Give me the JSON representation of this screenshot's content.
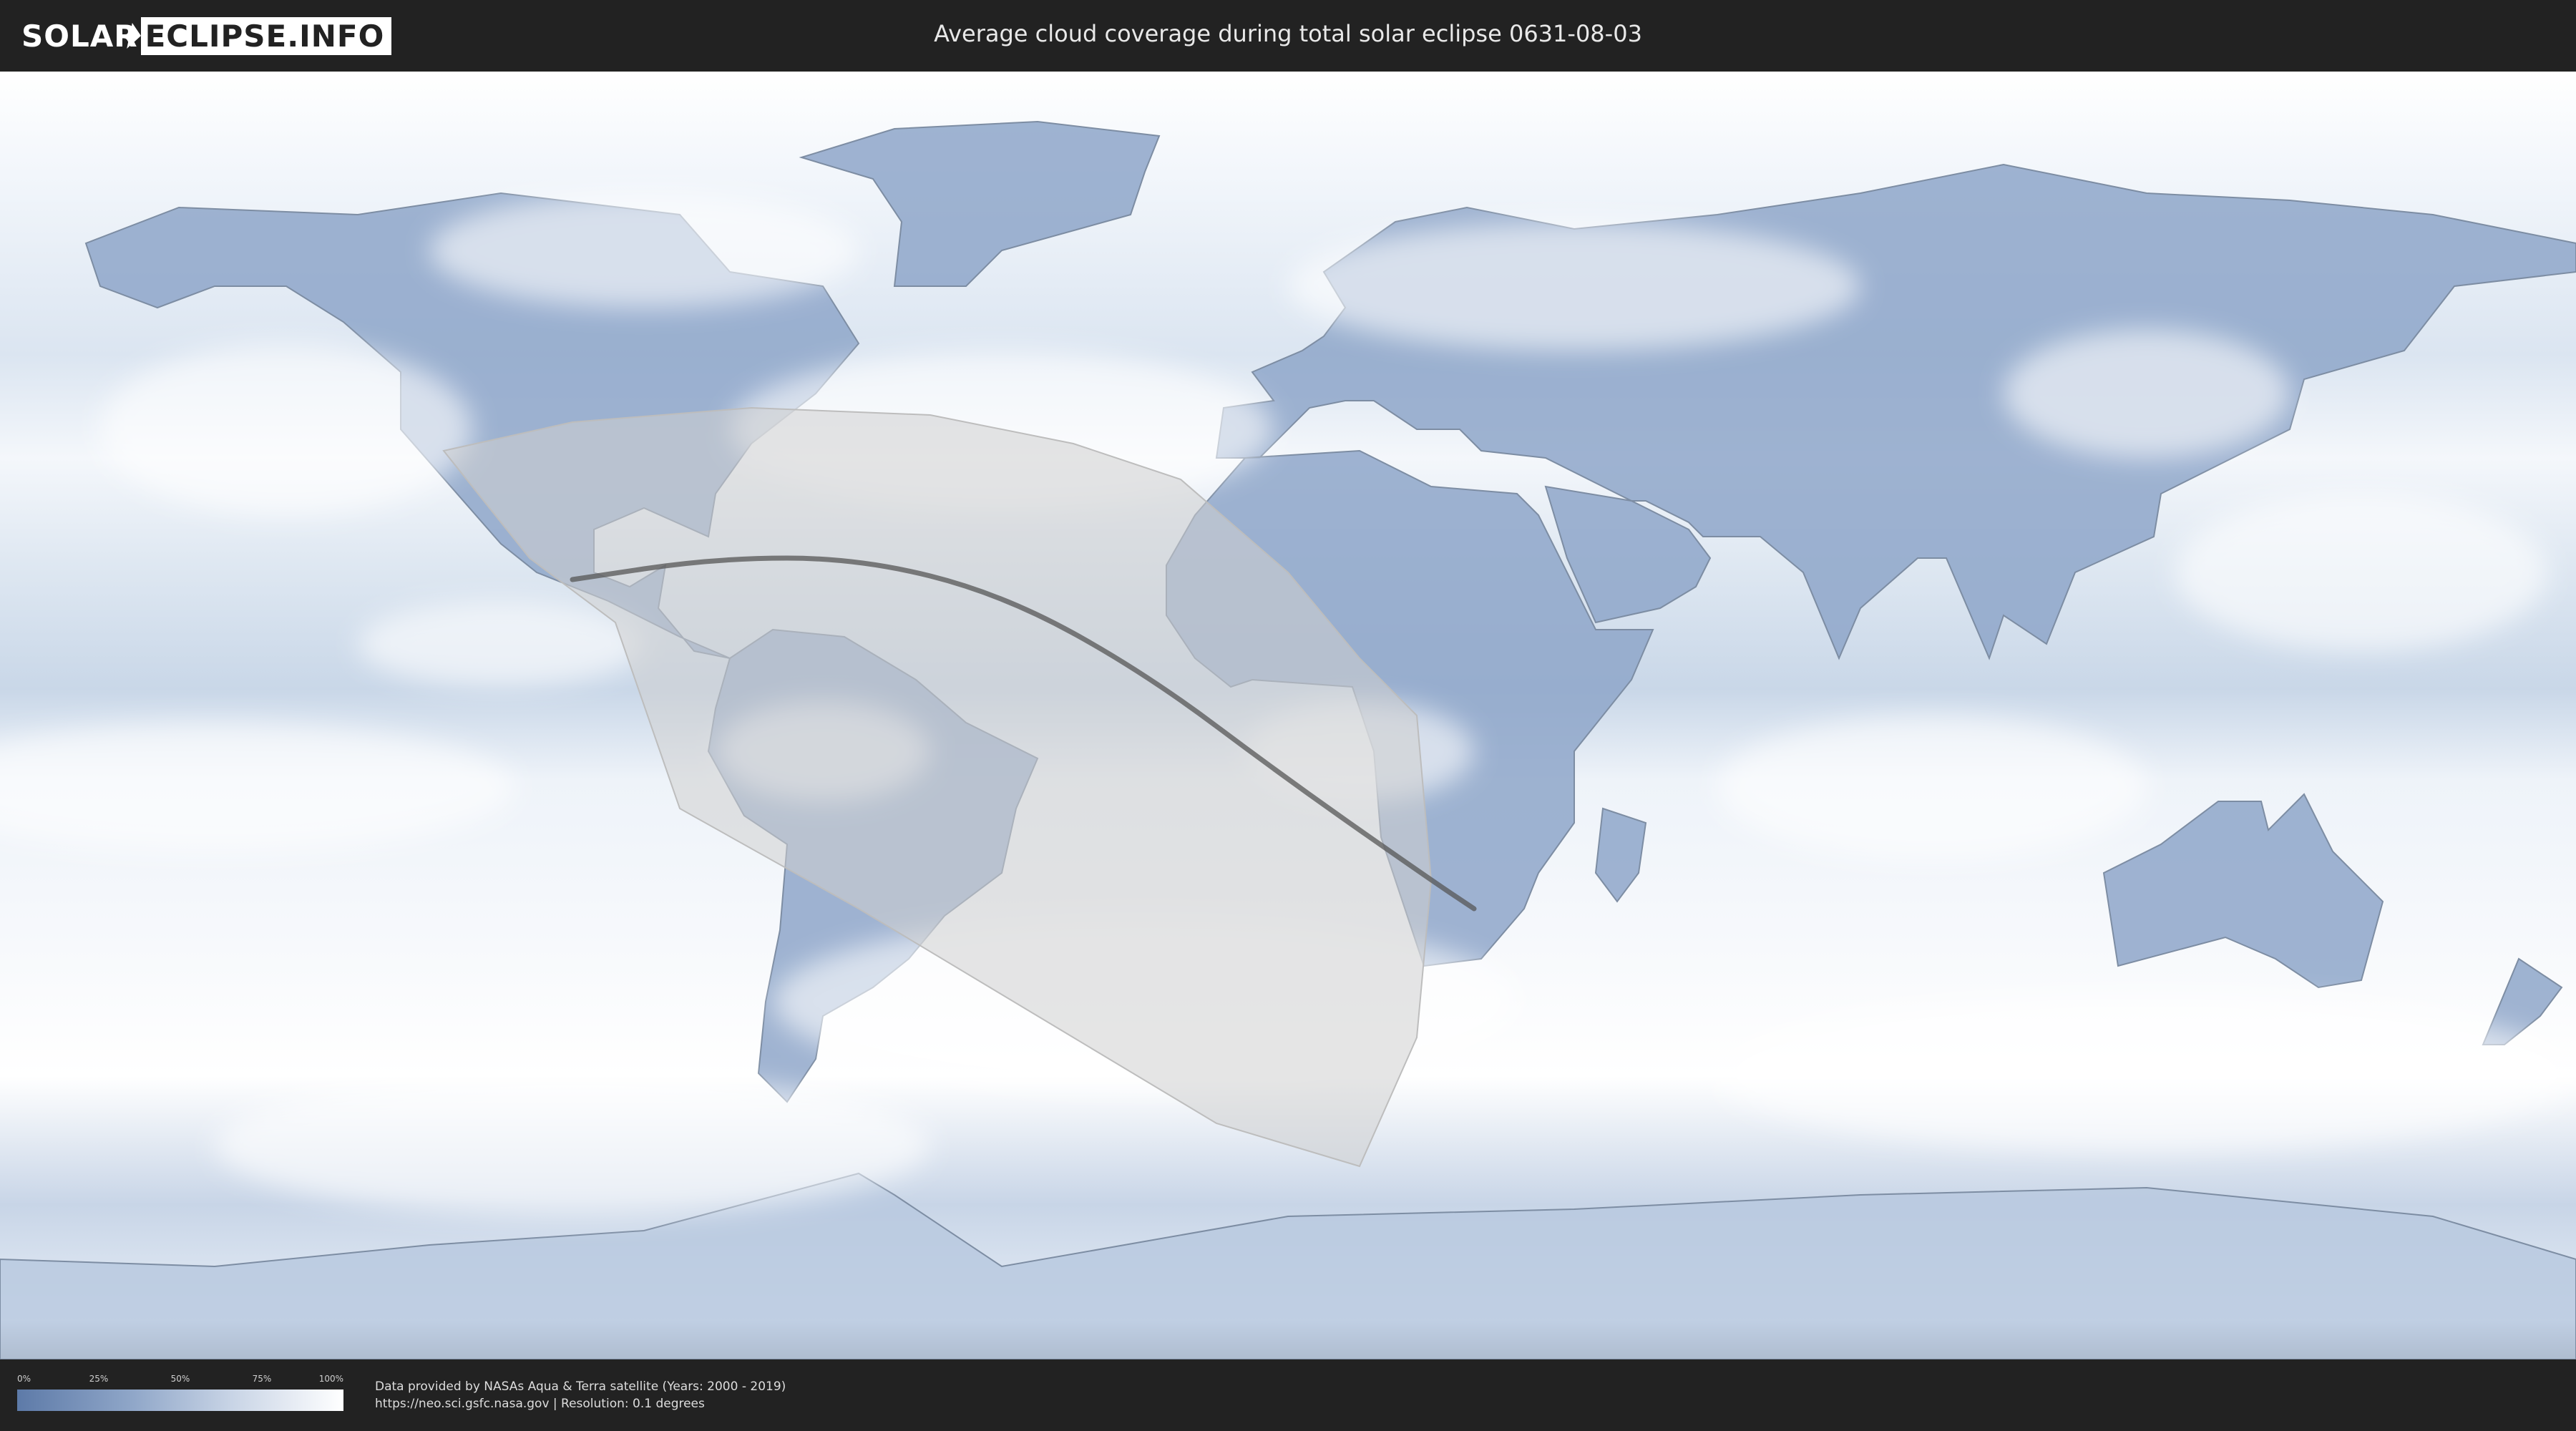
{
  "header": {
    "logo_left": "SOLAR",
    "logo_right": "ECLIPSE.INFO",
    "title": "Average cloud coverage during total solar eclipse 0631-08-03"
  },
  "map": {
    "projection": "equirectangular",
    "eclipse_date": "0631-08-03",
    "colors": {
      "clear": "#5d7aa8",
      "cloudy": "#ffffff",
      "shadow_overlay": "#cfcfcf",
      "central_line": "#555555"
    },
    "central_line": [
      {
        "lon": -100,
        "lat": 19
      },
      {
        "lon": -80,
        "lat": 22
      },
      {
        "lon": -60,
        "lat": 22
      },
      {
        "lon": -40,
        "lat": 17
      },
      {
        "lon": -20,
        "lat": 6
      },
      {
        "lon": 0,
        "lat": -9
      },
      {
        "lon": 20,
        "lat": -23
      },
      {
        "lon": 26,
        "lat": -27
      }
    ],
    "partial_region_outline": [
      {
        "lon": -118,
        "lat": 37
      },
      {
        "lon": -100,
        "lat": 41
      },
      {
        "lon": -75,
        "lat": 43
      },
      {
        "lon": -50,
        "lat": 42
      },
      {
        "lon": -30,
        "lat": 38
      },
      {
        "lon": -15,
        "lat": 33
      },
      {
        "lon": 0,
        "lat": 20
      },
      {
        "lon": 10,
        "lat": 8
      },
      {
        "lon": 18,
        "lat": 0
      },
      {
        "lon": 20,
        "lat": -23
      },
      {
        "lon": 18,
        "lat": -45
      },
      {
        "lon": 10,
        "lat": -63
      },
      {
        "lon": -10,
        "lat": -57
      },
      {
        "lon": -30,
        "lat": -45
      },
      {
        "lon": -60,
        "lat": -27
      },
      {
        "lon": -85,
        "lat": -13
      },
      {
        "lon": -94,
        "lat": 13
      },
      {
        "lon": -106,
        "lat": 22
      },
      {
        "lon": -118,
        "lat": 37
      }
    ]
  },
  "legend": {
    "ticks": [
      "0%",
      "25%",
      "50%",
      "75%",
      "100%"
    ]
  },
  "credits": {
    "line1": "Data provided by NASAs Aqua & Terra satellite (Years: 2000 - 2019)",
    "line2": "https://neo.sci.gsfc.nasa.gov | Resolution: 0.1 degrees"
  }
}
